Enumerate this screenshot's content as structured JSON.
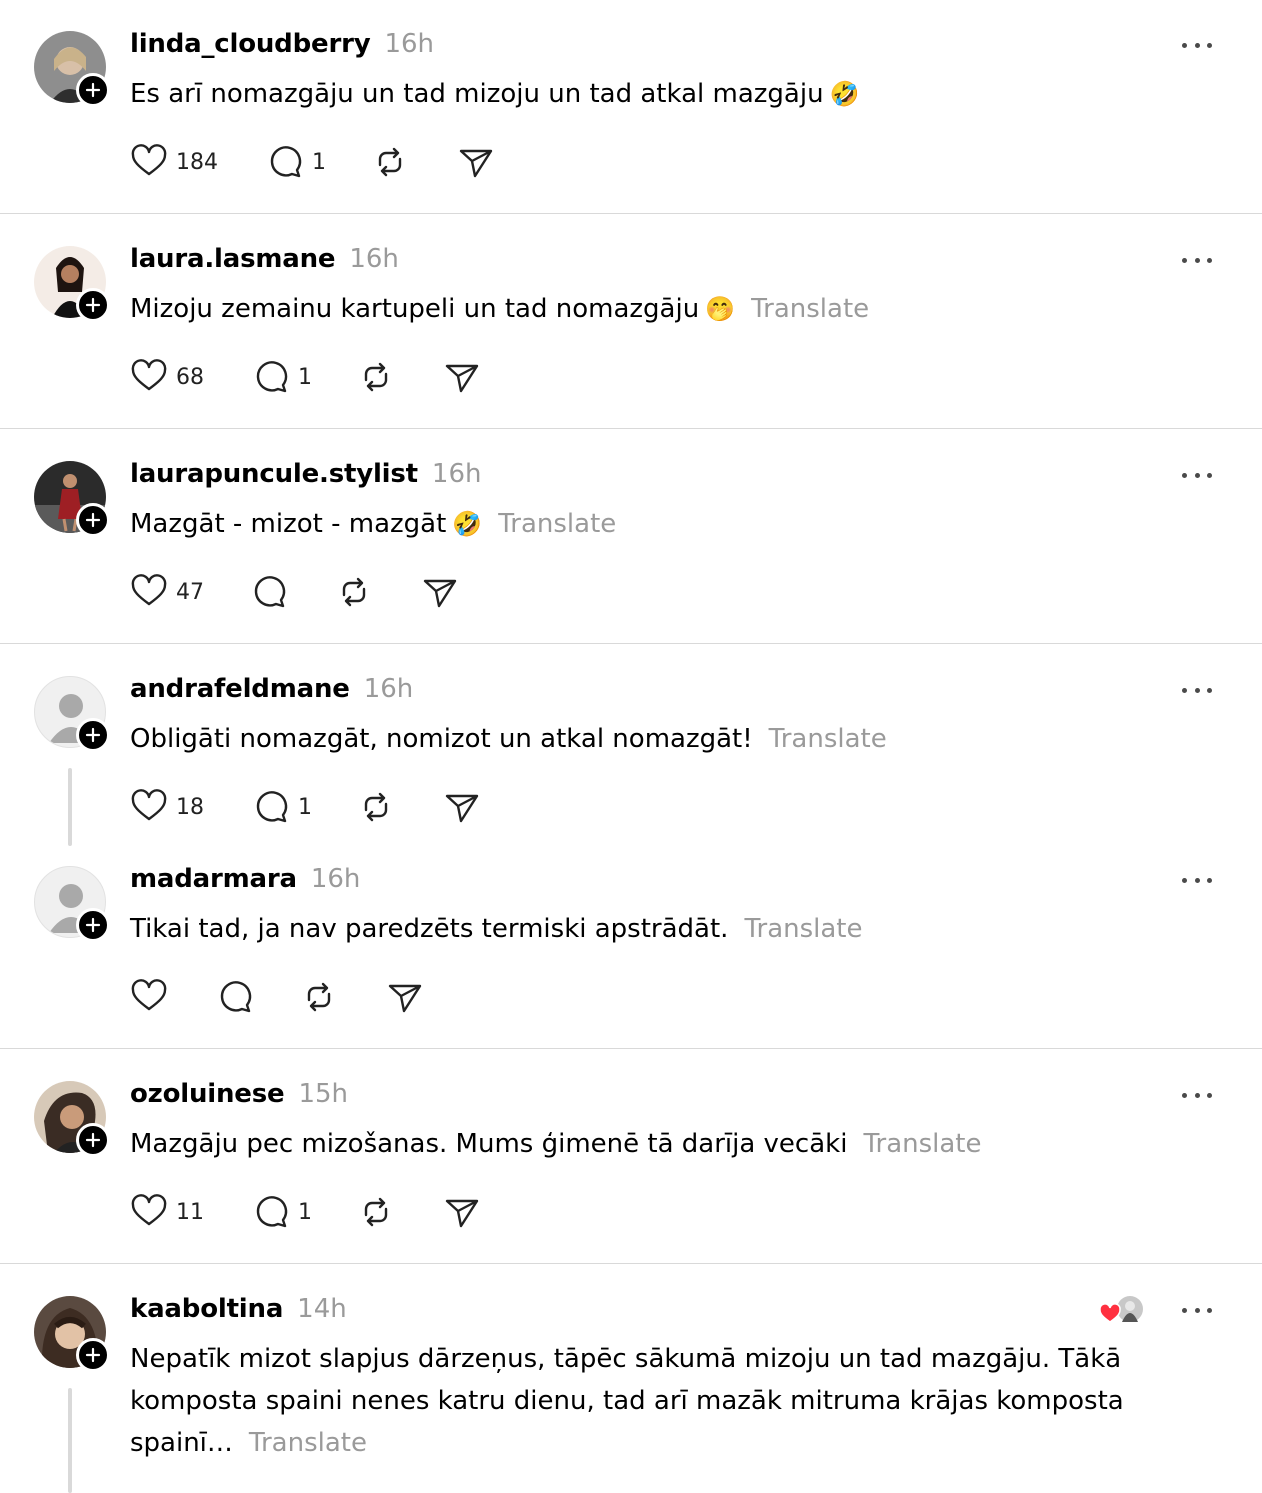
{
  "posts": [
    {
      "username": "linda_cloudberry",
      "time": "16h",
      "text": "Es arī nomazgāju un tad mizoju un tad atkal mazgāju",
      "emoji": "🤣",
      "translate": "",
      "likes": "184",
      "replies": "1",
      "avatar_color": "#6b6b6b"
    },
    {
      "username": "laura.lasmane",
      "time": "16h",
      "text": "Mizoju zemainu kartupeli un tad nomazgāju",
      "emoji": "🤭",
      "translate": "Translate",
      "likes": "68",
      "replies": "1",
      "avatar_color": "#c9a888"
    },
    {
      "username": "laurapuncule.stylist",
      "time": "16h",
      "text": "Mazgāt - mizot - mazgāt",
      "emoji": "🤣",
      "translate": "Translate",
      "likes": "47",
      "replies": "",
      "avatar_color": "#3a2a2a"
    },
    {
      "username": "andrafeldmane",
      "time": "16h",
      "text": "Obligāti nomazgāt, nomizot un atkal nomazgāt!",
      "emoji": "",
      "translate": "Translate",
      "likes": "18",
      "replies": "1",
      "avatar_color": "default"
    },
    {
      "username": "madarmara",
      "time": "16h",
      "text": "Tikai tad, ja nav paredzēts termiski apstrādāt.",
      "emoji": "",
      "translate": "Translate",
      "likes": "",
      "replies": "",
      "avatar_color": "default"
    },
    {
      "username": "ozoluinese",
      "time": "15h",
      "text": "Mazgāju pec mizošanas. Mums ģimenē tā darīja vecāki",
      "emoji": "",
      "translate": "Translate",
      "likes": "11",
      "replies": "1",
      "avatar_color": "#8a6a50"
    },
    {
      "username": "kaaboltina",
      "time": "14h",
      "text_lines": [
        "Nepatīk mizot slapjus dārzeņus, tāpēc sākumā mizoju un tad mazgāju. Tākā",
        "komposta spaini nenes katru dienu, tad arī mazāk mitruma krājas komposta",
        "spainī…"
      ],
      "translate": "Translate",
      "avatar_color": "#4a3a30"
    }
  ],
  "icons": {
    "like": "heart-icon",
    "reply": "comment-bubble-icon",
    "repost": "repost-icon",
    "share": "send-icon",
    "more": "more-dots-icon",
    "follow": "plus-icon"
  },
  "colors": {
    "muted": "#9a9a9a",
    "divider": "#d9d9d9",
    "liked_heart": "#ff3040"
  }
}
